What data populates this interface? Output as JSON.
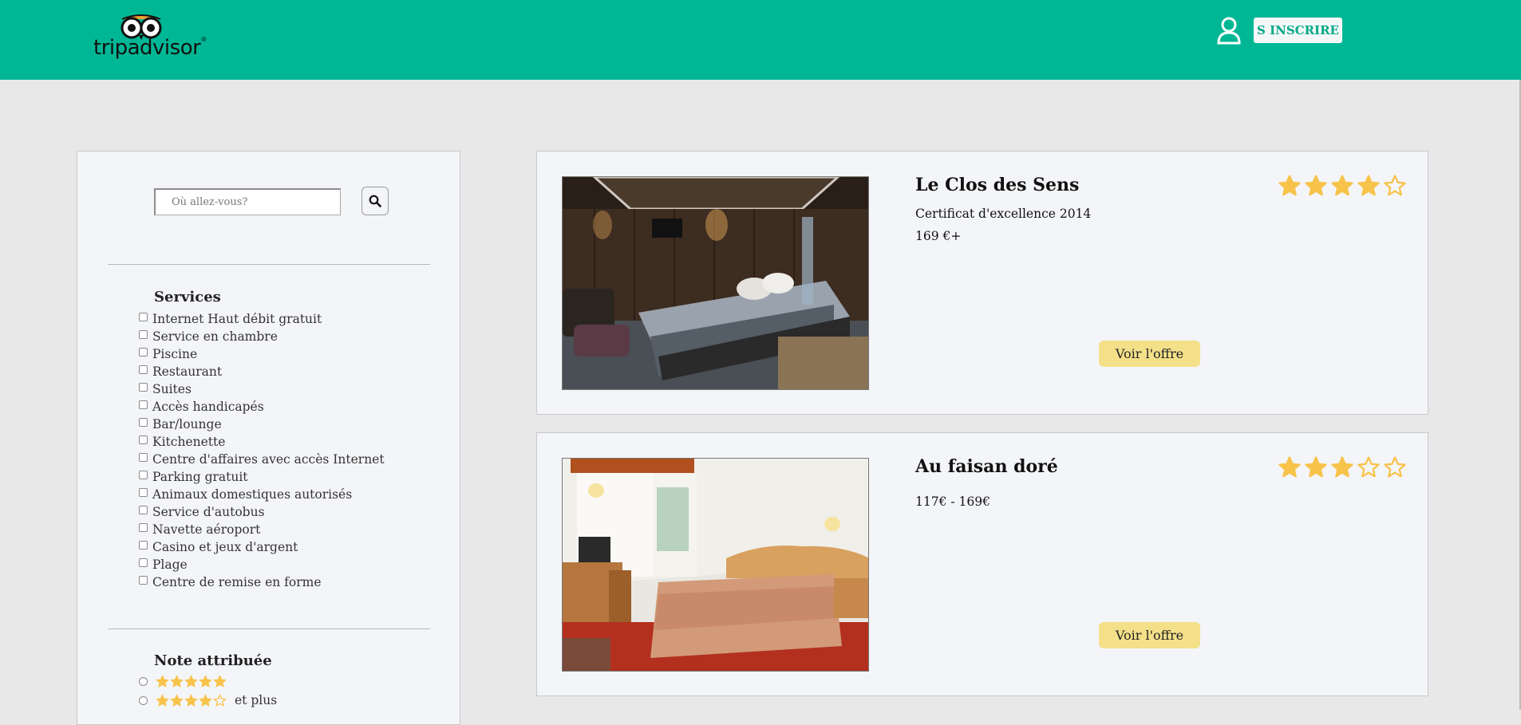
{
  "header": {
    "logo_text": "tripadvisor",
    "logo_reg": "®",
    "signup_label": "S INSCRIRE",
    "accent": "#00b795"
  },
  "search": {
    "placeholder": "Où allez-vous?",
    "icon": "search-icon"
  },
  "filters": {
    "services_title": "Services",
    "services": [
      "Internet Haut débit gratuit",
      "Service en chambre",
      "Piscine",
      "Restaurant",
      "Suites",
      "Accès handicapés",
      "Bar/lounge",
      "Kitchenette",
      "Centre d'affaires avec accès Internet",
      "Parking gratuit",
      "Animaux domestiques autorisés",
      "Service d'autobus",
      "Navette aéroport",
      "Casino et jeux d'argent",
      "Plage",
      "Centre de remise en forme"
    ],
    "rating_title": "Note attribuée",
    "ratings": [
      {
        "stars": 5,
        "suffix": ""
      },
      {
        "stars": 4,
        "suffix": "et plus"
      }
    ]
  },
  "hotels": [
    {
      "name": "Le Clos des Sens",
      "lines": [
        "Certificat d'excellence 2014",
        "169 €+"
      ],
      "rating": 4,
      "offer_label": "Voir l'offre"
    },
    {
      "name": "Au faisan doré",
      "lines": [
        "117€ - 169€"
      ],
      "rating": 3,
      "offer_label": "Voir l'offre"
    }
  ],
  "colors": {
    "star": "#f7c34a",
    "offer_button": "#f4e089"
  }
}
